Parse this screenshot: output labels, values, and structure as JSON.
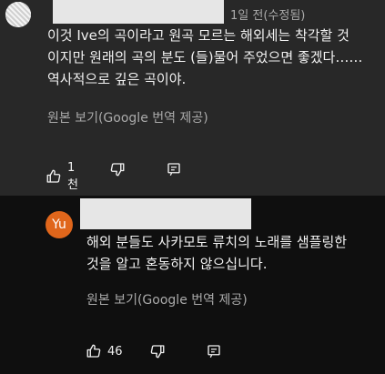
{
  "comments": [
    {
      "avatar_icon": "avatar-image",
      "time": "1일 전(수정됨)",
      "lines": [
        "이것 Ive의 곡이라고 원곡 모르는 해외세는 착각할 것",
        "이지만 원래의 곡의 분도 (들)물어 주었으면 좋겠다……",
        "역사적으로 깊은 곡이야."
      ],
      "translate_label": "원본 보기(Google 번역 제공)",
      "like_count": "1천",
      "icons": {
        "like": "thumbs-up-icon",
        "dislike": "thumbs-down-icon",
        "reply": "reply-icon"
      }
    },
    {
      "avatar_letter": "Yu",
      "avatar_color": "#e0661b",
      "lines": [
        "해외 분들도 사카모토 류치의 노래를 샘플링한",
        "것을 알고 혼동하지 않으십니다."
      ],
      "translate_label": "원본 보기(Google 번역 제공)",
      "like_count": "46",
      "icons": {
        "like": "thumbs-up-icon",
        "dislike": "thumbs-down-icon",
        "reply": "reply-icon"
      }
    }
  ],
  "colors": {
    "card_bg": "#282828",
    "page_bg": "#0f0f0f",
    "text": "#f1f1f1",
    "muted": "#aaaaaa"
  }
}
